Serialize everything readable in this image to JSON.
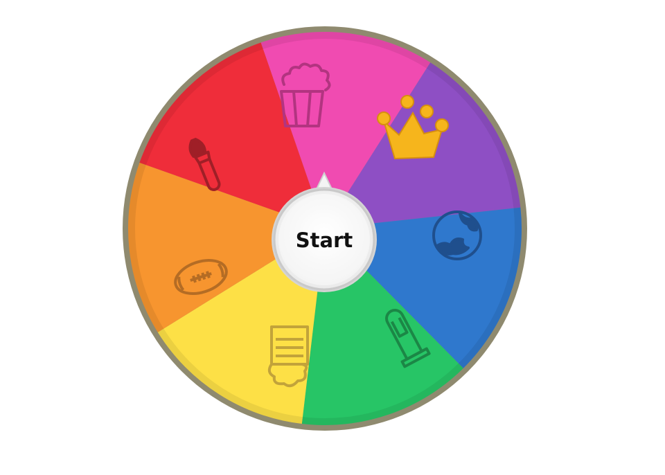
{
  "wheel": {
    "start_label": "Start",
    "rim_color": "#8f8a6f",
    "segments": [
      {
        "category": "entertainment",
        "icon": "popcorn-icon",
        "color": "#f04bb1",
        "icon_color": "#b23480"
      },
      {
        "category": "crown",
        "icon": "crown-icon",
        "color": "#8e4fc4",
        "icon_color": "#f6b51c"
      },
      {
        "category": "geography",
        "icon": "globe-icon",
        "color": "#2f78cd",
        "icon_color": "#1f4f8d"
      },
      {
        "category": "science",
        "icon": "test-tube-icon",
        "color": "#27c566",
        "icon_color": "#1b8746"
      },
      {
        "category": "history",
        "icon": "knight-helmet-icon",
        "color": "#fde046",
        "icon_color": "#c2a33a"
      },
      {
        "category": "sports",
        "icon": "football-icon",
        "color": "#f7952f",
        "icon_color": "#b46c24"
      },
      {
        "category": "art",
        "icon": "paintbrush-icon",
        "color": "#ef2d3a",
        "icon_color": "#9f1f27"
      }
    ]
  }
}
